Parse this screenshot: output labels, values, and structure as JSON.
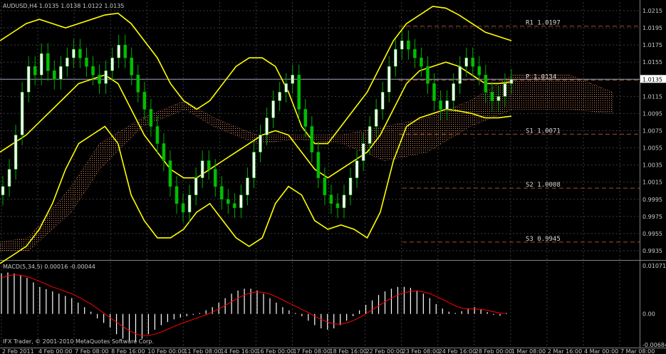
{
  "chart_data": {
    "type": "candlestick",
    "title": "AUDUSD,H4  1.0135 1.0138 1.0122 1.0135",
    "price_axis": {
      "ticks": [
        "1.0215",
        "1.0195",
        "1.0175",
        "1.0155",
        "1.0135",
        "1.0115",
        "1.0095",
        "1.0075",
        "1.0055",
        "1.0035",
        "1.0015",
        "0.9995",
        "0.9975",
        "0.9955",
        "0.9935"
      ],
      "current": "1.0135",
      "ylim": [
        0.9925,
        1.0225
      ]
    },
    "time_axis": {
      "ticks": [
        "2 Feb 2011",
        "4 Feb 00:00",
        "7 Feb 08:00",
        "8 Feb 16:00",
        "10 Feb 00:00",
        "11 Feb 08:00",
        "14 Feb 16:00",
        "16 Feb 00:00",
        "17 Feb 08:00",
        "18 Feb 16:00",
        "22 Feb 00:00",
        "23 Feb 08:00",
        "24 Feb 16:00",
        "28 Feb 00:00",
        "1 Mar 08:00",
        "2 Mar 16:00",
        "4 Mar 00:00",
        "7 Mar 08:00"
      ]
    },
    "pivots": [
      {
        "label": "R1",
        "value": "1.0197",
        "price": 1.0197
      },
      {
        "label": "P",
        "value": "1.0134",
        "price": 1.0134
      },
      {
        "label": "S1",
        "value": "1.0071",
        "price": 1.0071
      },
      {
        "label": "S2",
        "value": "1.0008",
        "price": 1.0008
      },
      {
        "label": "S3",
        "value": "0.9945",
        "price": 0.9945
      }
    ],
    "price_close": [
      1.001,
      1.003,
      1.007,
      1.012,
      1.015,
      1.014,
      1.0165,
      1.0145,
      1.0135,
      1.015,
      1.016,
      1.017,
      1.016,
      1.015,
      1.014,
      1.013,
      1.0145,
      1.016,
      1.0175,
      1.016,
      1.014,
      1.012,
      1.01,
      1.008,
      1.006,
      1.004,
      1.001,
      0.999,
      0.998,
      1.0,
      1.002,
      1.004,
      1.003,
      1.001,
      0.9995,
      0.999,
      0.9985,
      1.0,
      1.002,
      1.005,
      1.007,
      1.009,
      1.011,
      1.012,
      1.013,
      1.014,
      1.01,
      1.008,
      1.005,
      1.002,
      1.0,
      0.999,
      0.9985,
      1.0,
      1.002,
      1.004,
      1.006,
      1.008,
      1.01,
      1.012,
      1.015,
      1.017,
      1.018,
      1.017,
      1.016,
      1.015,
      1.013,
      1.011,
      1.01,
      1.011,
      1.013,
      1.015,
      1.016,
      1.015,
      1.014,
      1.012,
      1.011,
      1.0115,
      1.013,
      1.0135
    ],
    "bollinger_upper": [
      1.018,
      1.019,
      1.02,
      1.0205,
      1.02,
      1.0195,
      1.02,
      1.0205,
      1.021,
      1.0212,
      1.02,
      1.018,
      1.016,
      1.013,
      1.011,
      1.01,
      1.011,
      1.013,
      1.015,
      1.016,
      1.016,
      1.015,
      1.012,
      1.008,
      1.006,
      1.006,
      1.008,
      1.01,
      1.012,
      1.015,
      1.018,
      1.02,
      1.021,
      1.022,
      1.0218,
      1.021,
      1.02,
      1.019,
      1.0185,
      1.018
    ],
    "bollinger_lower": [
      0.992,
      0.993,
      0.994,
      0.996,
      0.999,
      1.003,
      1.006,
      1.007,
      1.008,
      1.006,
      1.0,
      0.997,
      0.995,
      0.995,
      0.996,
      0.998,
      0.999,
      0.997,
      0.995,
      0.994,
      0.995,
      0.999,
      1.001,
      1.0,
      0.997,
      0.996,
      0.9965,
      0.996,
      0.995,
      0.998,
      1.004,
      1.008,
      1.009,
      1.0095,
      1.01,
      1.0098,
      1.0095,
      1.009,
      1.009,
      1.0092
    ],
    "bollinger_mid": [
      1.005,
      1.006,
      1.007,
      1.0085,
      1.01,
      1.0115,
      1.013,
      1.0135,
      1.014,
      1.013,
      1.01,
      1.007,
      1.005,
      1.003,
      1.002,
      1.002,
      1.003,
      1.004,
      1.005,
      1.006,
      1.007,
      1.0075,
      1.007,
      1.005,
      1.003,
      1.002,
      1.003,
      1.004,
      1.005,
      1.007,
      1.01,
      1.013,
      1.0145,
      1.015,
      1.0155,
      1.015,
      1.014,
      1.013,
      1.013,
      1.0132
    ],
    "macd": {
      "label": "MACD(5,34,5) 0.00016 -0.00044",
      "ticks": [
        "0.01071",
        "0.00",
        "-0.00684"
      ],
      "ylim": [
        -0.00684,
        0.01071
      ],
      "histogram": [
        0.009,
        0.0092,
        0.009,
        0.0085,
        0.008,
        0.007,
        0.006,
        0.0055,
        0.005,
        0.0045,
        0.004,
        0.0035,
        0.0025,
        0.0015,
        0.0005,
        -0.001,
        -0.002,
        -0.003,
        -0.0045,
        -0.0055,
        -0.006,
        -0.0062,
        -0.0055,
        -0.0045,
        -0.0035,
        -0.0025,
        -0.0018,
        -0.0012,
        -0.0008,
        -0.0005,
        -0.0002,
        0.0002,
        0.0008,
        0.0015,
        0.0025,
        0.0035,
        0.0045,
        0.0052,
        0.0056,
        0.0056,
        0.0052,
        0.0045,
        0.0035,
        0.0025,
        0.0015,
        0.0008,
        0.0002,
        -0.0005,
        -0.0015,
        -0.0025,
        -0.0032,
        -0.0035,
        -0.0032,
        -0.0025,
        -0.0015,
        -0.0005,
        0.0008,
        0.002,
        0.003,
        0.0042,
        0.005,
        0.0056,
        0.006,
        0.006,
        0.0058,
        0.0052,
        0.0045,
        0.0035,
        0.0022,
        0.0012,
        0.0005,
        0.0002,
        0.0006,
        0.0012,
        0.0015,
        0.001,
        0.0004,
        -0.0002,
        -0.0004,
        0.0002
      ],
      "signal": [
        0.008,
        0.0085,
        0.0087,
        0.0086,
        0.0083,
        0.0078,
        0.0072,
        0.0066,
        0.006,
        0.0055,
        0.005,
        0.0045,
        0.0038,
        0.003,
        0.0022,
        0.0012,
        0.0002,
        -0.0008,
        -0.0018,
        -0.0028,
        -0.0037,
        -0.0044,
        -0.0048,
        -0.0048,
        -0.0045,
        -0.004,
        -0.0034,
        -0.0028,
        -0.0022,
        -0.0017,
        -0.0012,
        -0.0007,
        -0.0002,
        0.0004,
        0.0011,
        0.0019,
        0.0027,
        0.0035,
        0.0042,
        0.0047,
        0.0049,
        0.0048,
        0.0044,
        0.0038,
        0.0031,
        0.0024,
        0.0017,
        0.001,
        0.0003,
        -0.0005,
        -0.0012,
        -0.0018,
        -0.0022,
        -0.0023,
        -0.002,
        -0.0015,
        -0.0008,
        0.0,
        0.0009,
        0.0018,
        0.0027,
        0.0035,
        0.0042,
        0.0047,
        0.005,
        0.0051,
        0.0049,
        0.0045,
        0.0039,
        0.0032,
        0.0025,
        0.0018,
        0.0013,
        0.0011,
        0.0011,
        0.001,
        0.0008,
        0.0005,
        0.0002,
        0.0001
      ]
    }
  },
  "footer": "IFX Trader, © 2001-2010 MetaQuotes Software Corp.",
  "colors": {
    "background": "#000000",
    "grid": "#3a3a3a",
    "candle_up": "#ffffff",
    "candle_down": "#ffffff",
    "candle_body_green": "#00c000",
    "bollinger": "#ffff00",
    "tenkan": "#ff0000",
    "kijun": "#0000ff",
    "lagging": "#00aa00",
    "cloud": "#d9855a",
    "pivot_line": "#a05030",
    "pivot_text": "#d8d8d8",
    "current_price": "#9aa2b8",
    "macd_hist": "#ffffff",
    "macd_signal": "#ff0000"
  }
}
